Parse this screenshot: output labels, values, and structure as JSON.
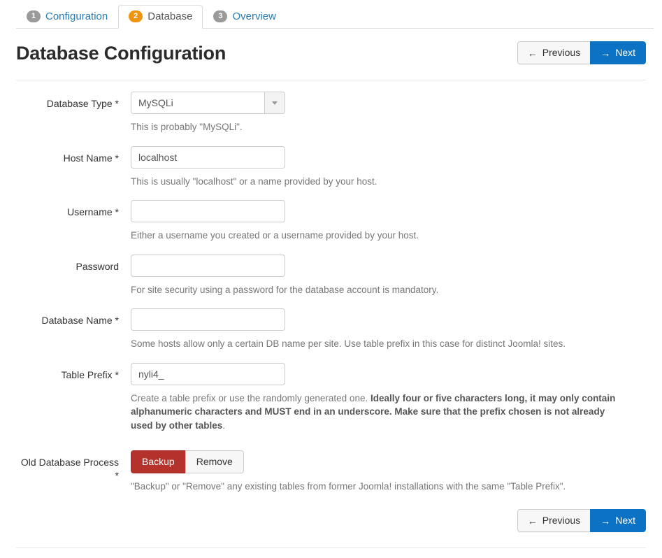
{
  "tabs": [
    {
      "number": "1",
      "label": "Configuration",
      "active": false
    },
    {
      "number": "2",
      "label": "Database",
      "active": true
    },
    {
      "number": "3",
      "label": "Overview",
      "active": false
    }
  ],
  "header": {
    "title": "Database Configuration"
  },
  "nav_buttons": {
    "previous_label": "Previous",
    "previous_arrow": "←",
    "next_label": "Next",
    "next_arrow": "→"
  },
  "form": {
    "database_type": {
      "label": "Database Type *",
      "value": "MySQLi",
      "help": "This is probably \"MySQLi\"."
    },
    "host_name": {
      "label": "Host Name *",
      "value": "localhost",
      "placeholder": "",
      "help": "This is usually \"localhost\" or a name provided by your host."
    },
    "username": {
      "label": "Username *",
      "value": "",
      "placeholder": "",
      "help": "Either a username you created or a username provided by your host."
    },
    "password": {
      "label": "Password",
      "value": "",
      "placeholder": "",
      "help": "For site security using a password for the database account is mandatory."
    },
    "database_name": {
      "label": "Database Name *",
      "value": "",
      "placeholder": "",
      "help": "Some hosts allow only a certain DB name per site. Use table prefix in this case for distinct Joomla! sites."
    },
    "table_prefix": {
      "label": "Table Prefix *",
      "value": "nyli4_",
      "placeholder": "",
      "help_plain_start": "Create a table prefix or use the randomly generated one. ",
      "help_bold": "Ideally four or five characters long, it may only contain alphanumeric characters and MUST end in an underscore. Make sure that the prefix chosen is not already used by other tables",
      "help_plain_end": "."
    },
    "old_database_process": {
      "label": "Old Database Process *",
      "options": [
        {
          "label": "Backup",
          "selected": true
        },
        {
          "label": "Remove",
          "selected": false
        }
      ],
      "help": "\"Backup\" or \"Remove\" any existing tables from former Joomla! installations with the same \"Table Prefix\"."
    }
  },
  "colors": {
    "primary": "#0b72c4",
    "danger": "#b5312c",
    "active_badge": "#f0930f",
    "inactive_badge": "#9a9a9a",
    "link": "#2a7ab0"
  }
}
